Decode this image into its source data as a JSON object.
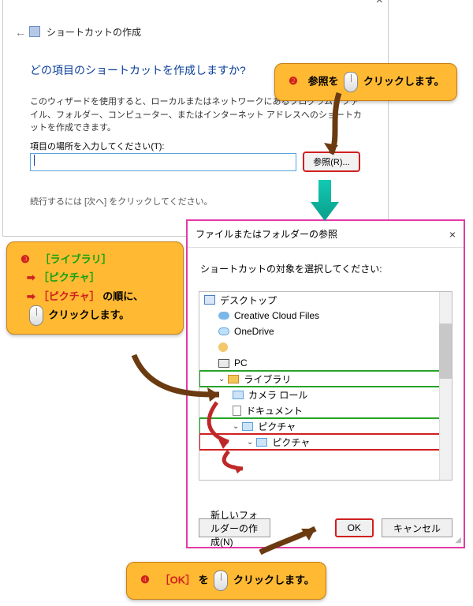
{
  "wizard": {
    "window_title": "ショートカットの作成",
    "heading": "どの項目のショートカットを作成しますか?",
    "description": "このウィザードを使用すると、ローカルまたはネットワークにあるプログラム、ファイル、フォルダー、コンピューター、またはインターネット アドレスへのショートカットを作成できます。",
    "location_label": "項目の場所を入力してください(T):",
    "browse_button": "参照(R)...",
    "next_hint": "続行するには [次へ] をクリックしてください。"
  },
  "browse_dialog": {
    "title": "ファイルまたはフォルダーの参照",
    "instruction": "ショートカットの対象を選択してください:",
    "new_folder_btn": "新しいフォルダーの作成(N)",
    "ok_btn": "OK",
    "cancel_btn": "キャンセル",
    "tree": {
      "desktop": "デスクトップ",
      "ccfiles": "Creative Cloud Files",
      "onedrive": "OneDrive",
      "user": "",
      "pc": "PC",
      "libraries": "ライブラリ",
      "cameraroll": "カメラ ロール",
      "documents": "ドキュメント",
      "pictures": "ピクチャ",
      "pictures_sub": "ピクチャ"
    }
  },
  "callouts": {
    "num2": "❷",
    "c2_a": "参照を",
    "c2_b": "クリックします。",
    "num3": "❸",
    "c3_lib": "［ライブラリ］",
    "c3_pic1": "［ピクチャ］",
    "c3_pic2": "［ピクチャ］",
    "c3_suffix": "の順に、",
    "c3_click": "クリックします。",
    "num4": "❹",
    "c4_ok": "［OK］",
    "c4_a": "を",
    "c4_b": "クリックします。"
  }
}
